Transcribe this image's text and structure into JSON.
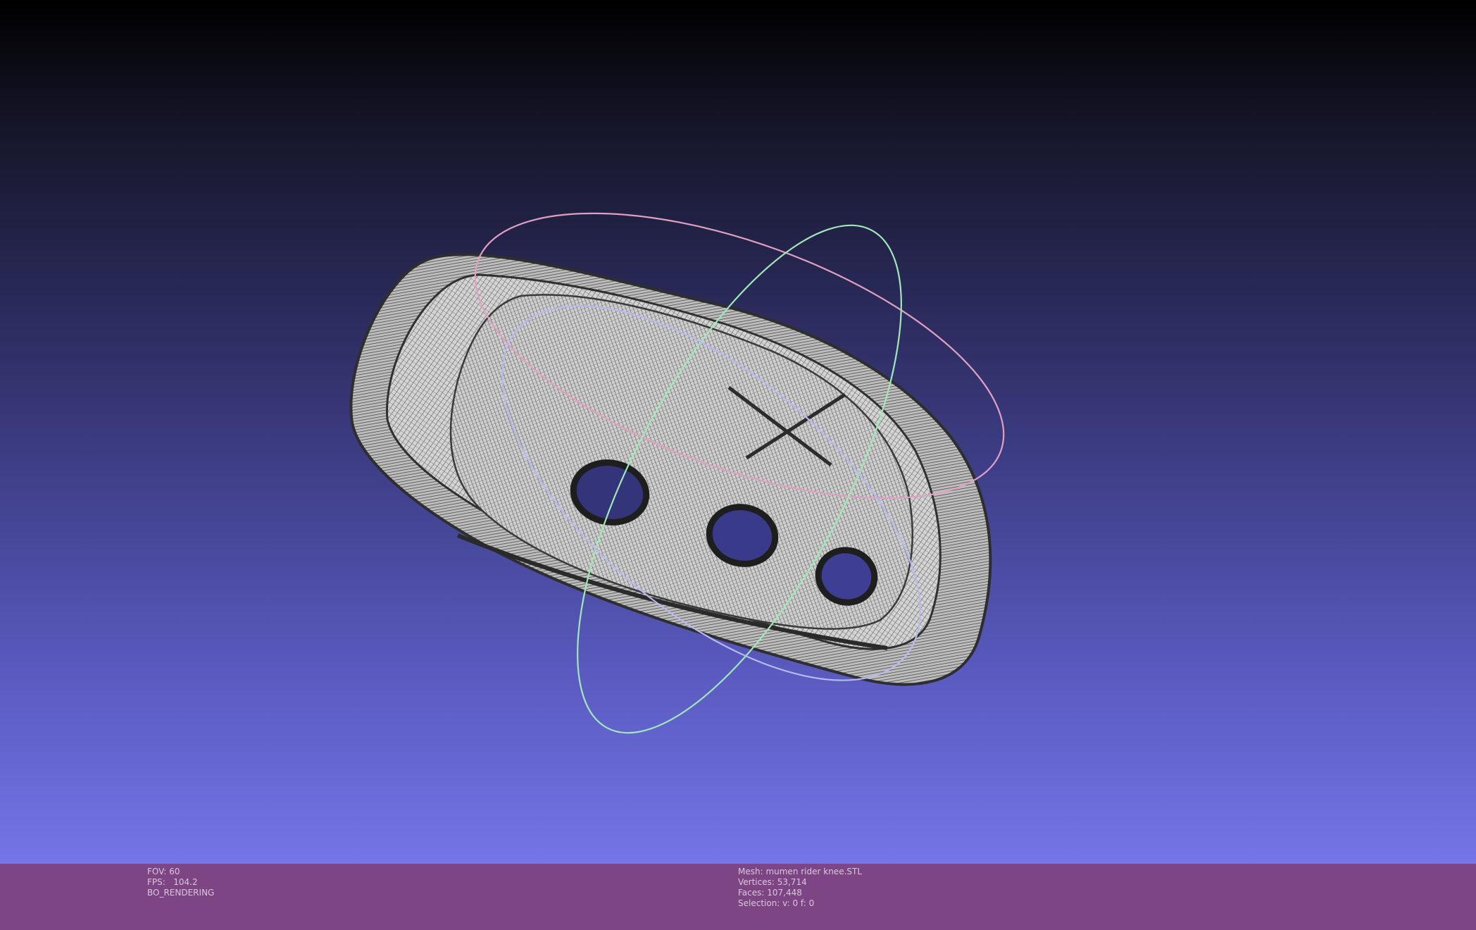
{
  "viewport": {
    "background_top": "#000000",
    "background_bottom": "#7575e8",
    "mesh_color": "#4a4a4a",
    "trackball_colors": {
      "x_ring": "#e2a0c0",
      "y_ring": "#a0e8b8",
      "z_ring": "#b8b8f0"
    }
  },
  "info_bar": {
    "background": "#7e4585",
    "left": {
      "fov": "FOV: 60",
      "fps": "FPS:   104.2",
      "mode": "BO_RENDERING"
    },
    "right": {
      "mesh": "Mesh: mumen rider knee.STL",
      "vertices": "Vertices: 53,714",
      "faces": "Faces: 107,448",
      "selection": "Selection: v: 0 f: 0"
    }
  }
}
